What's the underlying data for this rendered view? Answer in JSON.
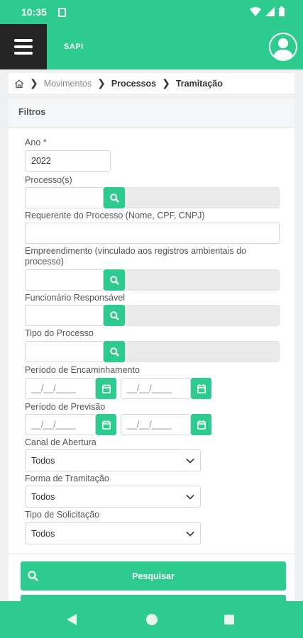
{
  "status_bar": {
    "time": "10:35"
  },
  "app_bar": {
    "logo": "SAPI"
  },
  "breadcrumb": {
    "items": [
      "Movimentos",
      "Processos",
      "Tramitação"
    ]
  },
  "filters": {
    "title": "Filtros",
    "ano_label": "Ano *",
    "ano_value": "2022",
    "processo_label": "Processo(s)",
    "requerente_label": "Requerente do Processo (Nome, CPF, CNPJ)",
    "empreendimento_label": "Empreendimento (vinculado aos registros ambientais do processo)",
    "funcionario_label": "Funcionário Responsável",
    "tipo_processo_label": "Tipo do Processo",
    "encaminhamento_label": "Período de Encaminhamento",
    "previsao_label": "Período de Previsão",
    "date_placeholder": "__/__/____",
    "canal_label": "Canal de Abertura",
    "canal_value": "Todos",
    "forma_label": "Forma de Tramitação",
    "forma_value": "Todos",
    "tipo_solicitacao_label": "Tipo de Solicitação",
    "tipo_solicitacao_value": "Todos"
  },
  "actions": {
    "search_label": "Pesquisar"
  },
  "colors": {
    "accent": "#2ecb8f",
    "menu_bg": "#252525"
  }
}
